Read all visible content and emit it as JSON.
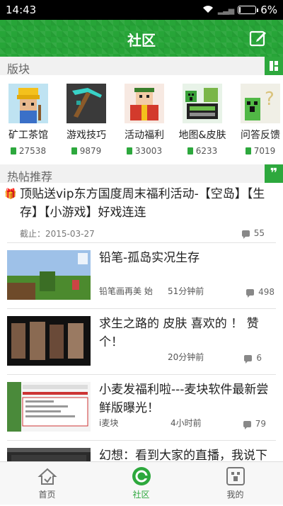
{
  "status_bar": {
    "time": "14:43",
    "battery": "6%"
  },
  "header": {
    "title": "社区"
  },
  "boards_section": {
    "label": "版块"
  },
  "boards": [
    {
      "name": "矿工茶馆",
      "count": "27538"
    },
    {
      "name": "游戏技巧",
      "count": "9879"
    },
    {
      "name": "活动福利",
      "count": "33003"
    },
    {
      "name": "地图&皮肤",
      "count": "6233"
    },
    {
      "name": "问答反馈",
      "count": "7019"
    }
  ],
  "hot_section": {
    "label": "热帖推荐"
  },
  "pinned_post": {
    "title": "顶贴送vip东方国度周末福利活动-【空岛】【生存】【小游戏】好戏连连",
    "date": "截止：2015-03-27",
    "comments": "55"
  },
  "posts": [
    {
      "title": "铅笔-孤岛实况生存",
      "author": "铅笔画再美 始",
      "time": "51分钟前",
      "comments": "498"
    },
    {
      "title": "求生之路的 皮肤 喜欢的 ！ 赞个！",
      "author": "",
      "time": "20分钟前",
      "comments": "6"
    },
    {
      "title": "小麦发福利啦---麦块软件最新尝鲜版曝光！",
      "author": "i麦块",
      "time": "4小时前",
      "comments": "79"
    },
    {
      "title": "幻想：看到大家的直播，我说下",
      "author": "",
      "time": "",
      "comments": ""
    }
  ],
  "tabbar": {
    "home": "首页",
    "community": "社区",
    "mine": "我的"
  },
  "colors": {
    "brand": "#2da83d"
  }
}
